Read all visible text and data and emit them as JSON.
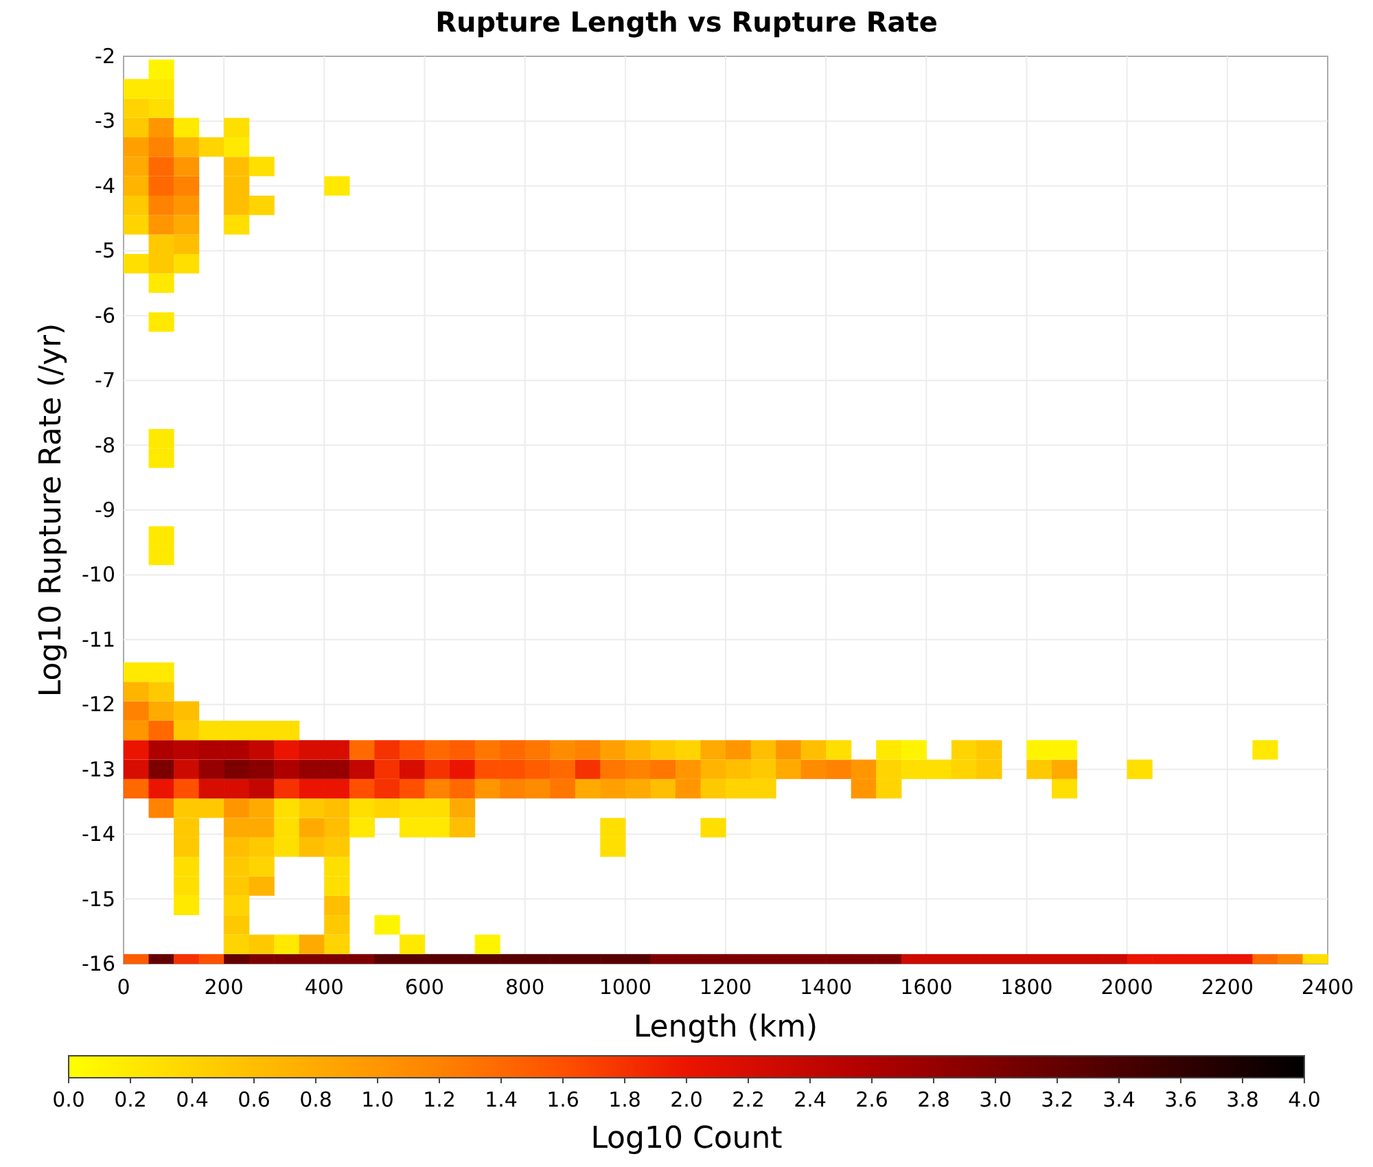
{
  "chart": {
    "title": "Rupture Length vs Rupture Rate",
    "xlabel": "Length (km)",
    "ylabel": "Log10 Rupture Rate (/yr)",
    "xticks": [
      "0",
      "200",
      "400",
      "600",
      "800",
      "1000",
      "1200",
      "1400",
      "1600",
      "1800",
      "2000",
      "2200",
      "2400"
    ],
    "yticks": [
      "-2",
      "-3",
      "-4",
      "-5",
      "-6",
      "-7",
      "-8",
      "-9",
      "-10",
      "-11",
      "-12",
      "-13",
      "-14",
      "-15",
      "-16"
    ]
  },
  "colorbar": {
    "label": "Log10 Count",
    "ticks": [
      "0.0",
      "0.2",
      "0.4",
      "0.6",
      "0.8",
      "1.0",
      "1.2",
      "1.4",
      "1.6",
      "1.8",
      "2.0",
      "2.2",
      "2.4",
      "2.6",
      "2.8",
      "3.0",
      "3.2",
      "3.4",
      "3.6",
      "3.8",
      "4.0"
    ]
  }
}
